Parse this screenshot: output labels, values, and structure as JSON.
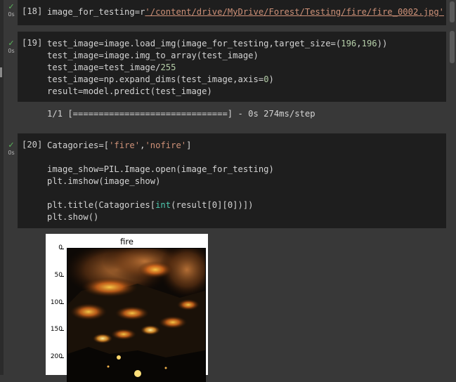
{
  "cells": [
    {
      "prompt": "[18]",
      "status": "✓",
      "duration": "0s",
      "code": {
        "prefix": "image_for_testing=r",
        "string": "'/content/drive/MyDrive/Forest/Testing/fire/fire_0002.jpg'"
      }
    },
    {
      "prompt": "[19]",
      "status": "✓",
      "duration": "0s",
      "code_lines": {
        "l1a": "test_image=image.load_img(image_for_testing,target_size=(",
        "l1n1": "196",
        "l1c": ",",
        "l1n2": "196",
        "l1b": "))",
        "l2": "test_image=image.img_to_array(test_image)",
        "l3a": "test_image=test_image/",
        "l3n": "255",
        "l4a": "test_image=np.expand_dims(test_image,axis=",
        "l4n": "0",
        "l4b": ")",
        "l5": "result=model.predict(test_image)"
      },
      "output": "1/1 [==============================] - 0s 274ms/step"
    },
    {
      "prompt": "[20]",
      "status": "✓",
      "duration": "0s",
      "code_lines": {
        "l1a": "Catagories=[",
        "l1s1": "'fire'",
        "l1c": ",",
        "l1s2": "'nofire'",
        "l1b": "]",
        "l2": "image_show=PIL.Image.open(image_for_testing)",
        "l3": "plt.imshow(image_show)",
        "l4a": "plt.title(Catagories[",
        "l4bi": "int",
        "l4b": "(result[0][0])])",
        "l5": "plt.show()"
      },
      "figure": {
        "title": "fire",
        "yticks": [
          "0",
          "50",
          "100",
          "150",
          "200"
        ]
      }
    }
  ],
  "colors": {
    "background": "#383838",
    "cell_background": "#1e1e1e",
    "check": "#5cb85c",
    "string": "#ce9178",
    "number": "#b5cea8",
    "builtin": "#4ec9b0"
  }
}
